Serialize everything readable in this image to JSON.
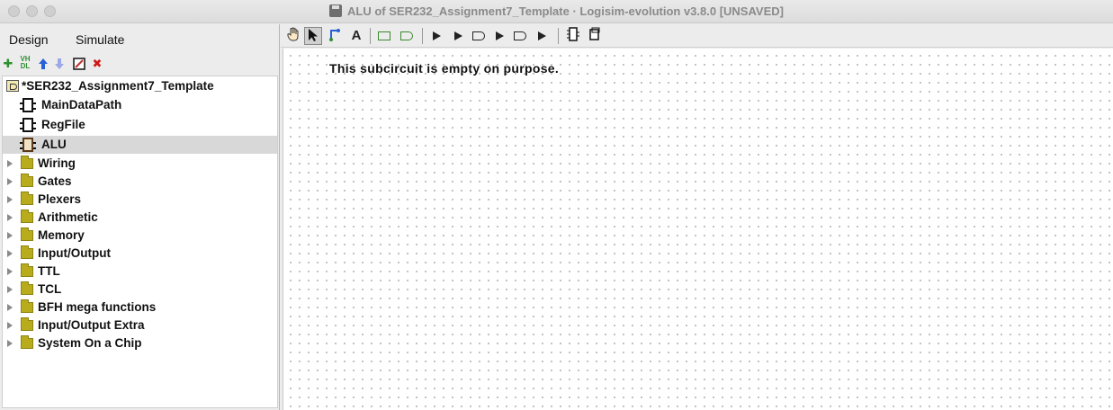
{
  "window": {
    "title": "ALU of SER232_Assignment7_Template · Logisim-evolution v3.8.0 [UNSAVED]"
  },
  "menus": [
    "Design",
    "Simulate"
  ],
  "left_toolbar": {
    "vhdl_label": "VH\nDL",
    "delete_glyph": "✖",
    "add_glyph": "✚"
  },
  "tree": {
    "project": "*SER232_Assignment7_Template",
    "circuits": [
      "MainDataPath",
      "RegFile",
      "ALU"
    ],
    "selected": "ALU",
    "libraries": [
      "Wiring",
      "Gates",
      "Plexers",
      "Arithmetic",
      "Memory",
      "Input/Output",
      "TTL",
      "TCL",
      "BFH mega functions",
      "Input/Output Extra",
      "System On a Chip"
    ]
  },
  "main_toolbar": {
    "text_tool_glyph": "A"
  },
  "canvas": {
    "message": "This subcircuit is empty on purpose."
  },
  "colors": {
    "folder": "#b9ac1c",
    "selection": "#d8d8d8",
    "add_green": "#2f8f2f",
    "delete_red": "#d01a1a",
    "arrow_blue": "#2860d8"
  }
}
